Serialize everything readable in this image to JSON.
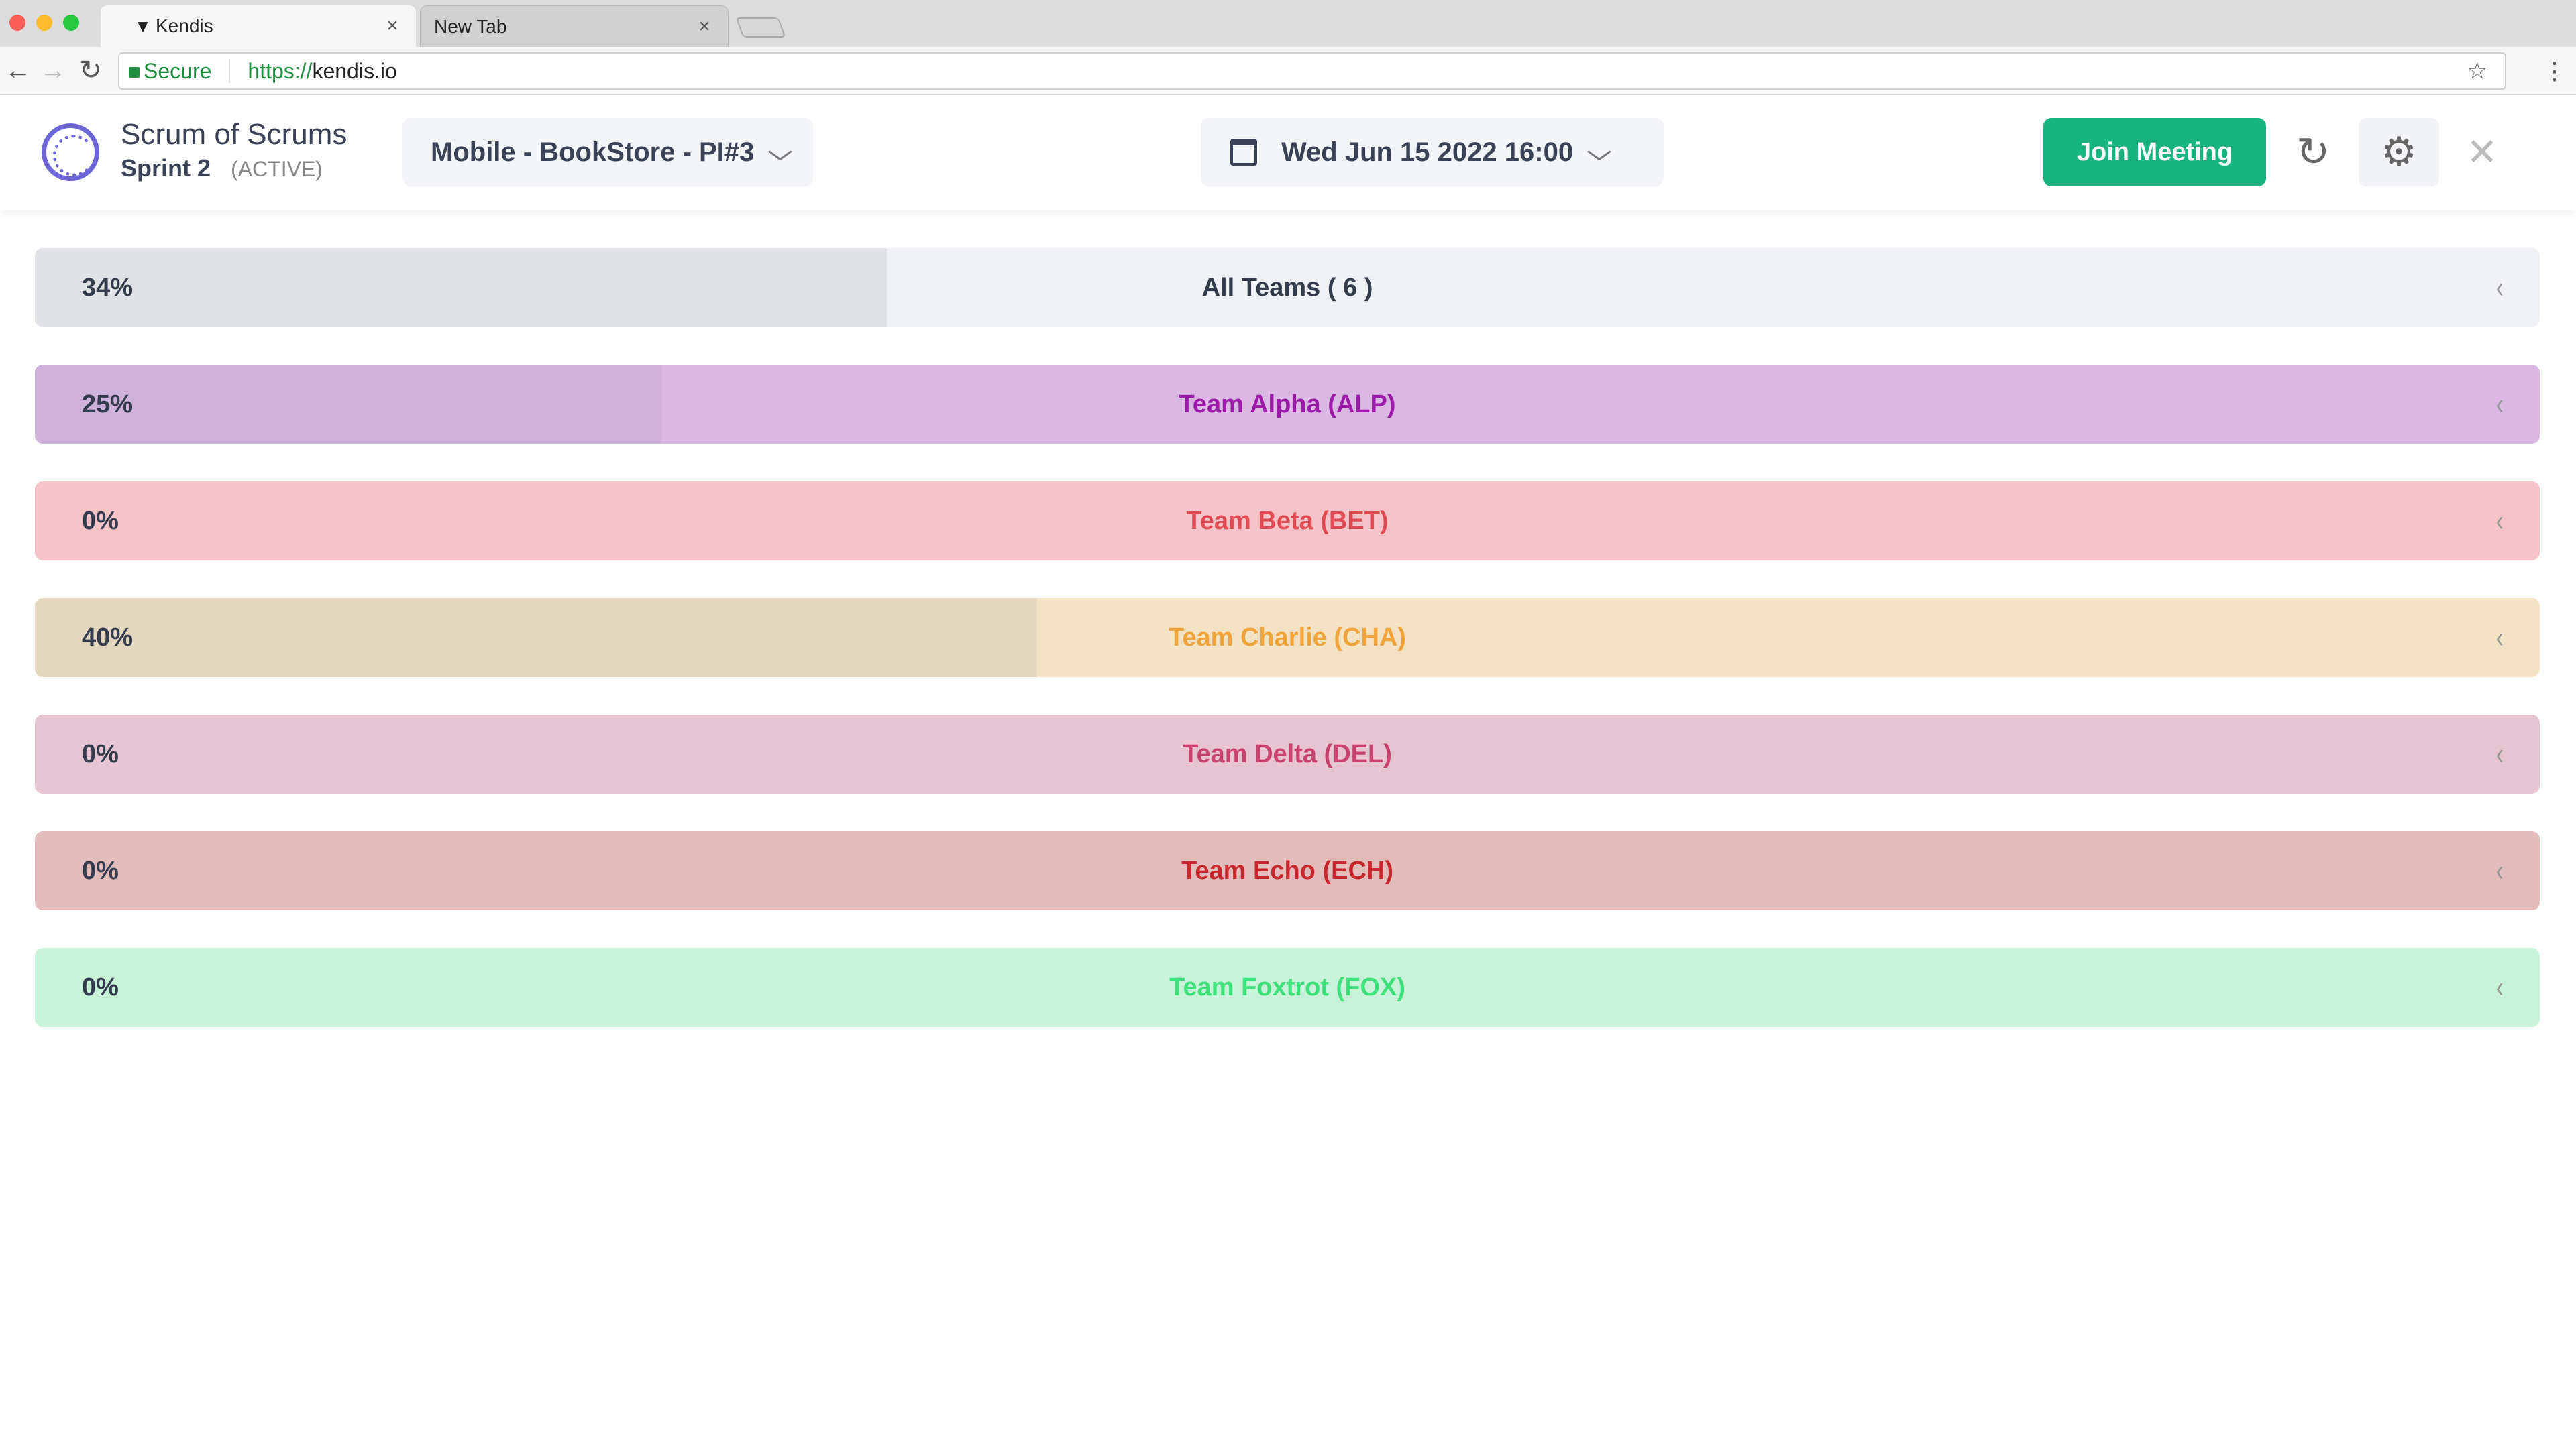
{
  "browser": {
    "tabs": [
      {
        "label": "Kendis",
        "favicon": "filter-icon",
        "close": "×"
      },
      {
        "label": "New Tab",
        "close": "×"
      }
    ],
    "nav": {
      "back": "←",
      "forward": "→",
      "reload": "↻"
    },
    "address": {
      "secure_label": "Secure",
      "url_scheme": "https://",
      "url_host": "kendis.io",
      "star": "☆",
      "menu": "⋮"
    }
  },
  "header": {
    "title": "Scrum of Scrums",
    "sprint": "Sprint 2",
    "sprint_state": "(ACTIVE)",
    "project_select": "Mobile - BookStore - PI#3",
    "date_select": "Wed Jun 15 2022 16:00",
    "chevron": "⌵",
    "join_label": "Join Meeting",
    "refresh_glyph": "↻",
    "settings_glyph": "⚙",
    "close_glyph": "✕",
    "accent": "#17b47f",
    "logo_color": "#6d66d8"
  },
  "teams": [
    {
      "percent": "34%",
      "progress": 0.34,
      "name": "All Teams ( 6 )",
      "bg": "#f0f1f4",
      "fill": "#e1e2e5",
      "text": "#333b4d"
    },
    {
      "percent": "25%",
      "progress": 0.25,
      "name": "Team Alpha (ALP)",
      "bg": "#dab8e3",
      "fill": "#cfb2da",
      "text": "#9b1aa8"
    },
    {
      "percent": "0%",
      "progress": 0,
      "name": "Team Beta (BET)",
      "bg": "#f4c4c8",
      "fill": "#e9bcc0",
      "text": "#e04a55"
    },
    {
      "percent": "40%",
      "progress": 0.4,
      "name": "Team Charlie (CHA)",
      "bg": "#f3e2c3",
      "fill": "#e3d8bf",
      "text": "#f0a43a"
    },
    {
      "percent": "0%",
      "progress": 0,
      "name": "Team Delta (DEL)",
      "bg": "#e7c4d2",
      "fill": "#dcbccb",
      "text": "#c9426f"
    },
    {
      "percent": "0%",
      "progress": 0,
      "name": "Team Echo (ECH)",
      "bg": "#e3bdbc",
      "fill": "#d9b5b4",
      "text": "#c8282d"
    },
    {
      "percent": "0%",
      "progress": 0,
      "name": "Team Foxtrot (FOX)",
      "bg": "#c8f3d9",
      "fill": "#bfe9cf",
      "text": "#3ee07c"
    }
  ],
  "row_arrow": "‹"
}
